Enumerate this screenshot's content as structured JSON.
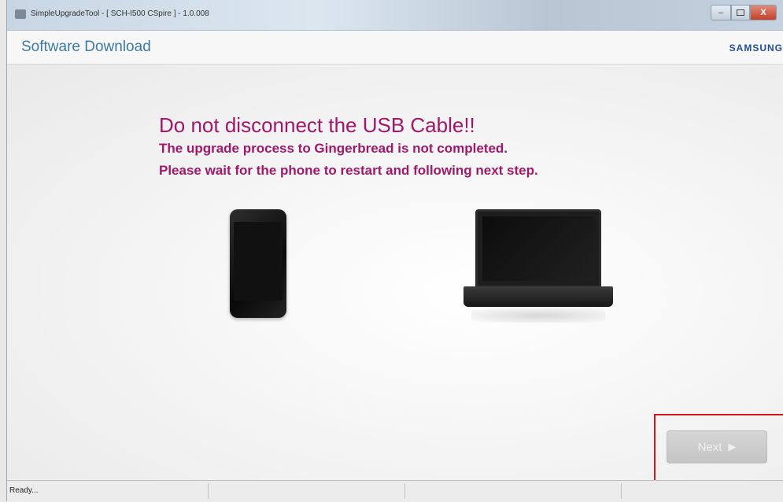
{
  "window": {
    "title": "SimpleUpgradeTool - [ SCH-I500 CSpire ] - 1.0.008",
    "controls": {
      "minimize": "–",
      "maximize": "",
      "close": "X"
    }
  },
  "header": {
    "title": "Software Download",
    "brand": "SAMSUNG"
  },
  "message": {
    "headline": "Do not disconnect the USB Cable!!",
    "line1": "The upgrade process to Gingerbread is not completed.",
    "line2": "Please wait for the phone to restart and following next step."
  },
  "images": {
    "phone": "smartphone-image",
    "laptop": "laptop-image"
  },
  "actions": {
    "next_label": "Next",
    "next_icon": "play-arrow-icon",
    "next_enabled": false,
    "highlight_color": "#d9161c"
  },
  "status": {
    "text": "Ready..."
  },
  "colors": {
    "header_title": "#3d7aa8",
    "message": "#a0186a",
    "brand": "#1f4e9a"
  }
}
